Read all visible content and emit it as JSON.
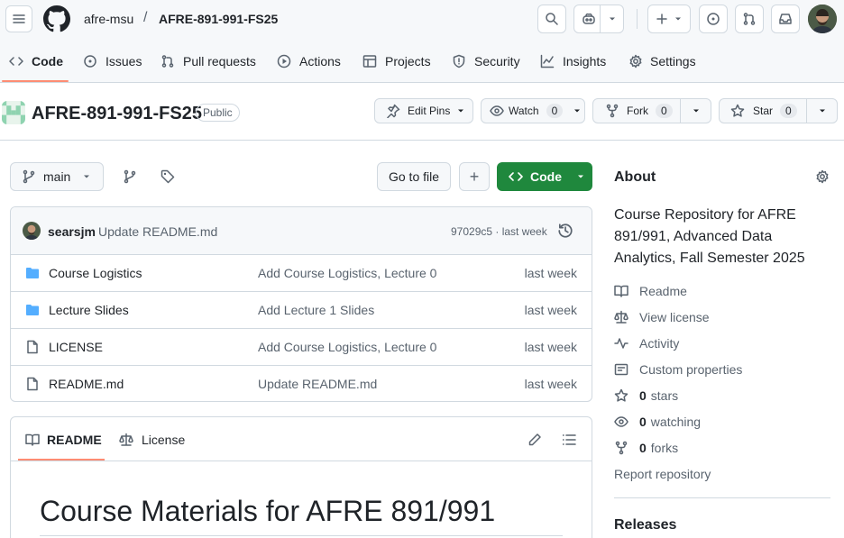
{
  "header": {
    "owner": "afre-msu",
    "separator": "/",
    "repo": "AFRE-891-991-FS25",
    "plus_label": "+"
  },
  "tabs": [
    {
      "label": "Code",
      "icon": "code-icon",
      "selected": true
    },
    {
      "label": "Issues",
      "icon": "issue-icon"
    },
    {
      "label": "Pull requests",
      "icon": "pull-request-icon"
    },
    {
      "label": "Actions",
      "icon": "play-icon"
    },
    {
      "label": "Projects",
      "icon": "table-icon"
    },
    {
      "label": "Security",
      "icon": "shield-icon"
    },
    {
      "label": "Insights",
      "icon": "graph-icon"
    },
    {
      "label": "Settings",
      "icon": "gear-icon"
    }
  ],
  "repo_header": {
    "title": "AFRE-891-991-FS25",
    "visibility": "Public",
    "edit_pins": "Edit Pins",
    "watch": {
      "label": "Watch",
      "count": "0"
    },
    "fork": {
      "label": "Fork",
      "count": "0"
    },
    "star": {
      "label": "Star",
      "count": "0"
    }
  },
  "toolbar": {
    "branch": "main",
    "go_to_file": "Go to file",
    "add": "+",
    "code": "Code"
  },
  "commit": {
    "author": "searsjm",
    "message": "Update README.md",
    "sha_time": "97029c5 · last week"
  },
  "files": [
    {
      "name": "Course Logistics",
      "type": "folder",
      "message": "Add Course Logistics, Lecture 0",
      "time": "last week"
    },
    {
      "name": "Lecture Slides",
      "type": "folder",
      "message": "Add Lecture 1 Slides",
      "time": "last week"
    },
    {
      "name": "LICENSE",
      "type": "file",
      "message": "Add Course Logistics, Lecture 0",
      "time": "last week"
    },
    {
      "name": "README.md",
      "type": "file",
      "message": "Update README.md",
      "time": "last week"
    }
  ],
  "readme": {
    "tab_readme": "README",
    "tab_license": "License",
    "heading": "Course Materials for AFRE 891/991"
  },
  "about": {
    "title": "About",
    "description": "Course Repository for AFRE 891/991, Advanced Data Analytics, Fall Semester 2025",
    "links": {
      "readme": "Readme",
      "license": "View license",
      "activity": "Activity",
      "custom": "Custom properties",
      "stars_count": "0",
      "stars_label": "stars",
      "watching_count": "0",
      "watching_label": "watching",
      "forks_count": "0",
      "forks_label": "forks",
      "report": "Report repository"
    },
    "releases": "Releases"
  },
  "colors": {
    "accent_green": "#1f883d",
    "tab_underline": "#fd8c73",
    "folder_blue": "#54aeff"
  }
}
